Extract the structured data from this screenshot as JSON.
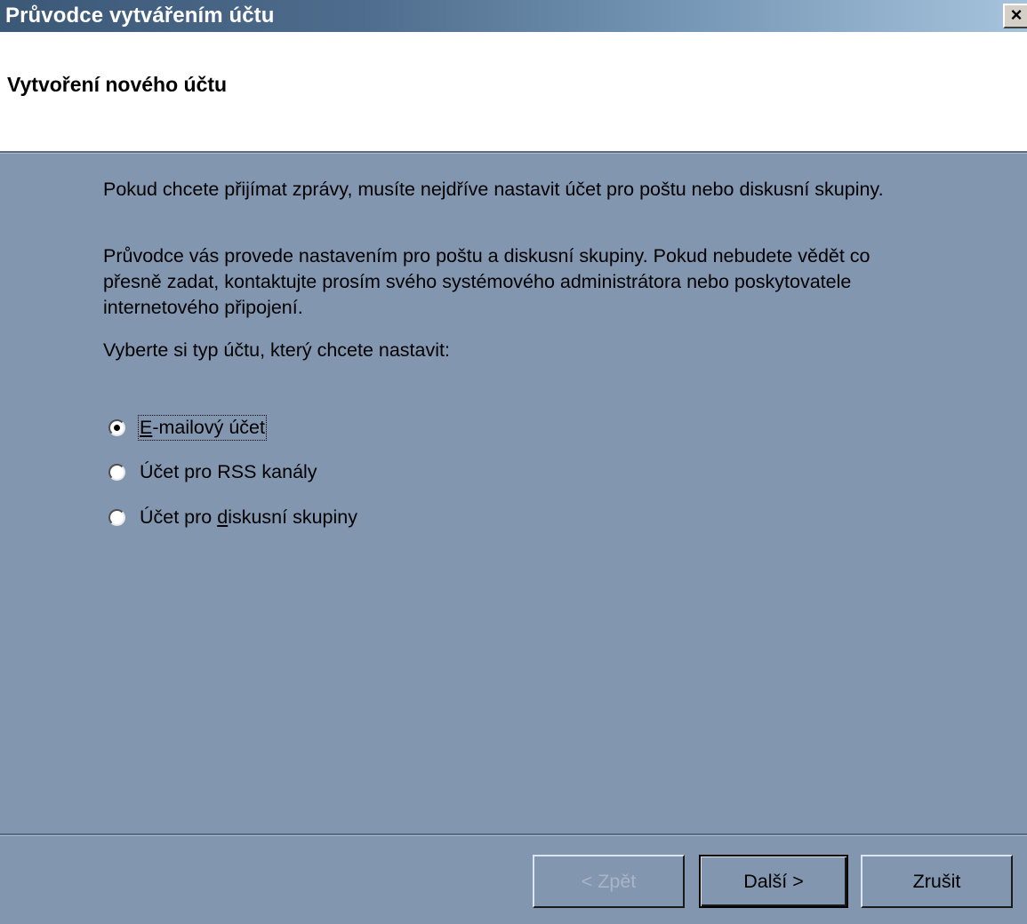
{
  "window": {
    "title": "Průvodce vytvářením účtu",
    "close_label": "×"
  },
  "header": {
    "title": "Vytvoření nového účtu"
  },
  "body": {
    "paragraph1": "Pokud chcete přijímat zprávy, musíte nejdříve nastavit účet pro poštu nebo diskusní skupiny.",
    "paragraph2": "Průvodce vás provede nastavením pro poštu a diskusní skupiny. Pokud nebudete vědět co přesně zadat, kontaktujte prosím svého systémového administrátora nebo poskytovatele internetového připojení.",
    "prompt": "Vyberte si typ účtu, který chcete nastavit:"
  },
  "options": [
    {
      "prefix": "",
      "mnemonic": "E",
      "suffix": "-mailový účet",
      "selected": true
    },
    {
      "prefix": "Účet pro RSS kanály",
      "mnemonic": "",
      "suffix": "",
      "selected": false
    },
    {
      "prefix": "Účet pro ",
      "mnemonic": "d",
      "suffix": "iskusní skupiny",
      "selected": false
    }
  ],
  "buttons": {
    "back": "< Zpět",
    "next": "Další >",
    "cancel": "Zrušit"
  },
  "colors": {
    "background": "#8296b0",
    "header_bg": "#ffffff",
    "title_gradient_start": "#3b5877",
    "title_gradient_end": "#a7c3dc"
  }
}
